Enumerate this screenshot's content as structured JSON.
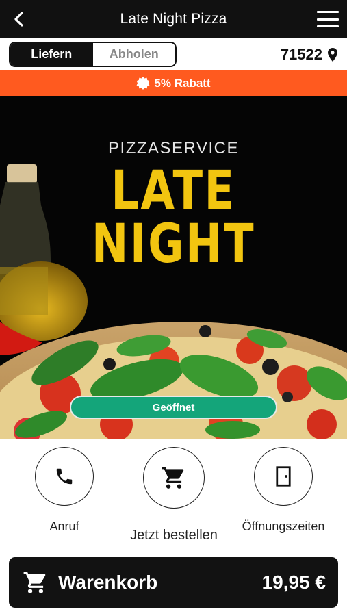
{
  "header": {
    "title": "Late Night Pizza",
    "back_icon": "chevron-left-icon",
    "menu_icon": "hamburger-menu-icon"
  },
  "mode": {
    "options": [
      {
        "label": "Liefern",
        "active": true
      },
      {
        "label": "Abholen",
        "active": false
      }
    ],
    "zip": "71522",
    "zip_icon": "location-pin-icon"
  },
  "discount": {
    "label": "5% Rabatt",
    "icon": "badge-icon",
    "color": "#ff5a1f"
  },
  "hero": {
    "brand_subtitle": "PIZZASERVICE",
    "brand_line1": "LATE",
    "brand_line2": "NIGHT",
    "brand_color": "#f2c510",
    "status_label": "Geöffnet",
    "status_color": "#14a57a"
  },
  "actions": [
    {
      "label": "Anruf",
      "icon": "phone-icon"
    },
    {
      "label": "Jetzt bestellen",
      "icon": "shopping-cart-icon"
    },
    {
      "label": "Öffnungszeiten",
      "icon": "door-icon"
    }
  ],
  "cart": {
    "label": "Warenkorb",
    "total": "19,95 €",
    "icon": "shopping-cart-icon"
  }
}
